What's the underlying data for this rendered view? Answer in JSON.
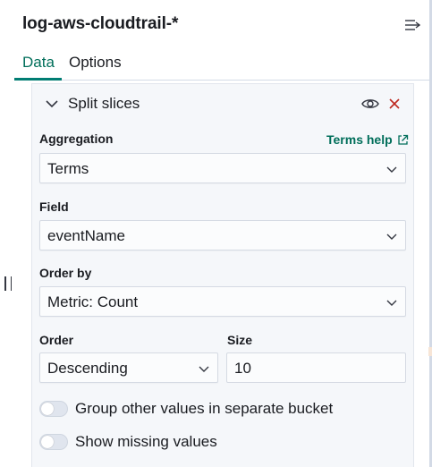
{
  "panel": {
    "index_pattern": "log-aws-cloudtrail-*",
    "collapse_icon": "collapse-sidebar-icon",
    "tabs": [
      {
        "label": "Data",
        "active": true
      },
      {
        "label": "Options",
        "active": false
      }
    ]
  },
  "split": {
    "title": "Split slices",
    "toggle_icon": "chevron-down-icon",
    "visibility_icon": "eye-icon",
    "remove_icon": "close-icon",
    "aggregation": {
      "label": "Aggregation",
      "help_link": "Terms help",
      "help_icon": "external-link-icon",
      "value": "Terms"
    },
    "field": {
      "label": "Field",
      "value": "eventName"
    },
    "order_by": {
      "label": "Order by",
      "value": "Metric: Count"
    },
    "order": {
      "label": "Order",
      "value": "Descending"
    },
    "size": {
      "label": "Size",
      "value": "10"
    },
    "switches": [
      {
        "label": "Group other values in separate bucket",
        "checked": false
      },
      {
        "label": "Show missing values",
        "checked": false
      }
    ]
  },
  "colors": {
    "accent": "#006e5a",
    "danger": "#bd271e",
    "text": "#1a1c21",
    "card_bg": "#f5f7fa"
  }
}
